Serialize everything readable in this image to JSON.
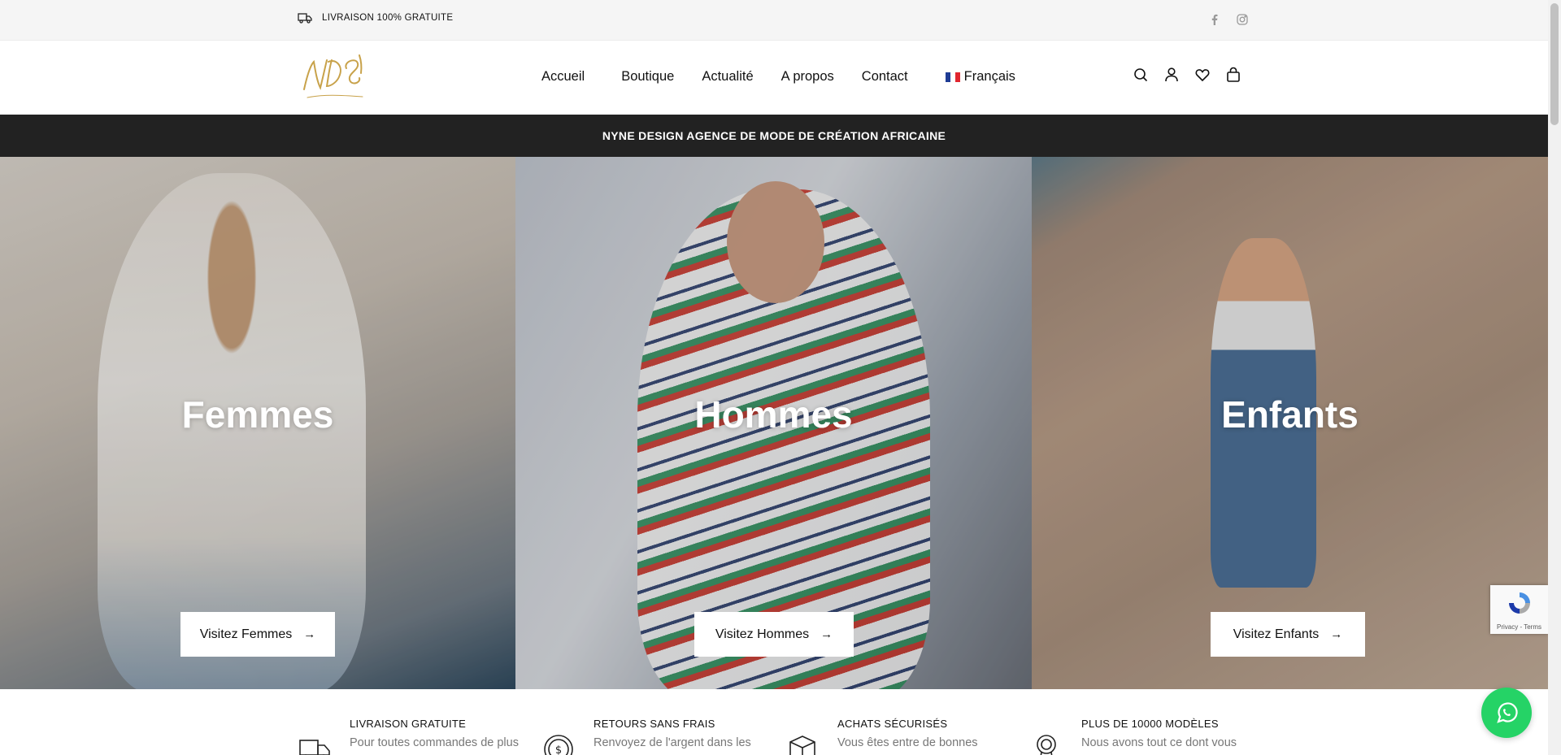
{
  "topbar": {
    "shipping_text": "LIVRAISON 100% GRATUITE",
    "social": [
      "facebook-icon",
      "instagram-icon"
    ]
  },
  "header": {
    "nav": {
      "home": "Accueil",
      "shop": "Boutique",
      "news": "Actualité",
      "about": "A propos",
      "contact": "Contact",
      "language": "Français"
    },
    "icons": [
      "search-icon",
      "account-icon",
      "wishlist-icon",
      "cart-icon"
    ]
  },
  "announcement": "NYNE DESIGN AGENCE DE MODE DE CRÉATION AFRICAINE",
  "categories": [
    {
      "title": "Femmes",
      "button": "Visitez Femmes"
    },
    {
      "title": "Hommes",
      "button": "Visitez Hommes"
    },
    {
      "title": "Enfants",
      "button": "Visitez Enfants"
    }
  ],
  "features": [
    {
      "title": "LIVRAISON GRATUITE",
      "text": "Pour toutes commandes de plus",
      "icon": "truck-icon"
    },
    {
      "title": "RETOURS SANS FRAIS",
      "text": "Renvoyez de l'argent dans les",
      "icon": "money-return-icon"
    },
    {
      "title": "ACHATS SÉCURISÉS",
      "text": "Vous êtes entre de bonnes",
      "icon": "secure-box-icon"
    },
    {
      "title": "PLUS DE 10000 MODÈLES",
      "text": "Nous avons tout ce dont vous",
      "icon": "medal-icon"
    }
  ],
  "recaptcha": {
    "text": "Privacy - Terms"
  },
  "colors": {
    "accent": "#c8a24a",
    "announcement_bg": "#222222",
    "whatsapp": "#25d366"
  }
}
